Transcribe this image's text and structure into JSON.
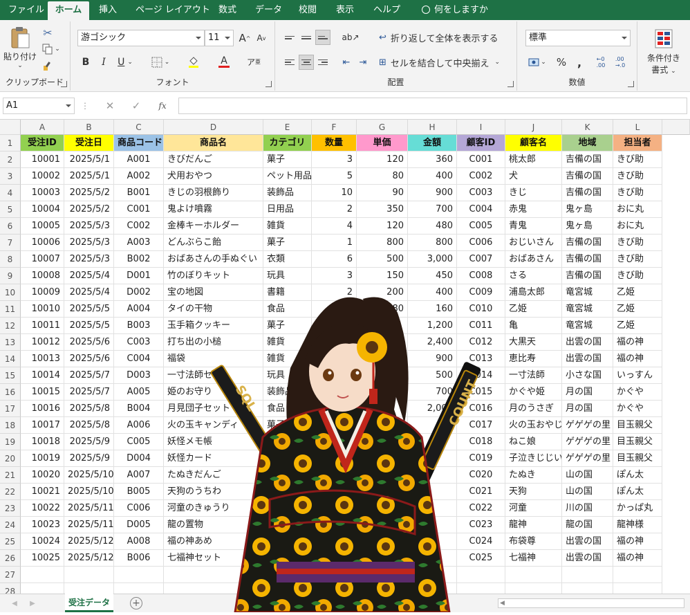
{
  "menu": {
    "tabs": [
      "ファイル",
      "ホーム",
      "挿入",
      "ページ レイアウト",
      "数式",
      "データ",
      "校閲",
      "表示",
      "ヘルプ"
    ],
    "active": "ホーム",
    "tell_me": "何をしますか"
  },
  "ribbon": {
    "clipboard": {
      "label": "クリップボード",
      "paste": "貼り付け"
    },
    "font": {
      "label": "フォント",
      "name": "游ゴシック",
      "size": "11",
      "grow": "A",
      "shrink": "A",
      "bold": "B",
      "italic": "I",
      "underline": "U"
    },
    "alignment": {
      "label": "配置",
      "wrap": "折り返して全体を表示する",
      "merge": "セルを結合して中央揃え"
    },
    "number": {
      "label": "数値",
      "format": "標準",
      "percent": "%",
      "comma": ","
    },
    "styles": {
      "conditional_line1": "条件付き",
      "conditional_line2": "書式"
    }
  },
  "formula_bar": {
    "name_box": "A1",
    "cancel": "✕",
    "enter": "✓",
    "fx": "fx",
    "content": ""
  },
  "sheet": {
    "columns": [
      "A",
      "B",
      "C",
      "D",
      "E",
      "F",
      "G",
      "H",
      "I",
      "J",
      "K",
      "L"
    ],
    "rows": [
      "1",
      "2",
      "3",
      "4",
      "5",
      "6",
      "7",
      "8",
      "9",
      "10",
      "11",
      "12",
      "13",
      "14",
      "15",
      "16",
      "17",
      "18",
      "19",
      "20",
      "21",
      "22",
      "23",
      "24",
      "25",
      "26",
      "27",
      "28"
    ],
    "header_colors": [
      "#92d050",
      "#ffff00",
      "#9bc2e6",
      "#ffe699",
      "#92d050",
      "#ffc000",
      "#ff99cc",
      "#66ddd6",
      "#b4a7d6",
      "#ffff00",
      "#a9d08e",
      "#f4b183"
    ],
    "headers": [
      "受注ID",
      "受注日",
      "商品コード",
      "商品名",
      "カテゴリ",
      "数量",
      "単価",
      "金額",
      "顧客ID",
      "顧客名",
      "地域",
      "担当者"
    ],
    "data": [
      [
        "10001",
        "2025/5/1",
        "A001",
        "きびだんご",
        "菓子",
        "3",
        "120",
        "360",
        "C001",
        "桃太郎",
        "吉備の国",
        "きび助"
      ],
      [
        "10002",
        "2025/5/1",
        "A002",
        "犬用おやつ",
        "ペット用品",
        "5",
        "80",
        "400",
        "C002",
        "犬",
        "吉備の国",
        "きび助"
      ],
      [
        "10003",
        "2025/5/2",
        "B001",
        "きじの羽根飾り",
        "装飾品",
        "10",
        "90",
        "900",
        "C003",
        "きじ",
        "吉備の国",
        "きび助"
      ],
      [
        "10004",
        "2025/5/2",
        "C001",
        "鬼よけ噴霧",
        "日用品",
        "2",
        "350",
        "700",
        "C004",
        "赤鬼",
        "鬼ヶ島",
        "おに丸"
      ],
      [
        "10005",
        "2025/5/3",
        "C002",
        "金棒キーホルダー",
        "雑貨",
        "4",
        "120",
        "480",
        "C005",
        "青鬼",
        "鬼ヶ島",
        "おに丸"
      ],
      [
        "10006",
        "2025/5/3",
        "A003",
        "どんぶらこ飴",
        "菓子",
        "1",
        "800",
        "800",
        "C006",
        "おじいさん",
        "吉備の国",
        "きび助"
      ],
      [
        "10007",
        "2025/5/3",
        "B002",
        "おばあさんの手ぬぐい",
        "衣類",
        "6",
        "500",
        "3,000",
        "C007",
        "おばあさん",
        "吉備の国",
        "きび助"
      ],
      [
        "10008",
        "2025/5/4",
        "D001",
        "竹のぼりキット",
        "玩具",
        "3",
        "150",
        "450",
        "C008",
        "さる",
        "吉備の国",
        "きび助"
      ],
      [
        "10009",
        "2025/5/4",
        "D002",
        "宝の地図",
        "書籍",
        "2",
        "200",
        "400",
        "C009",
        "浦島太郎",
        "竜宮城",
        "乙姫"
      ],
      [
        "10010",
        "2025/5/5",
        "A004",
        "タイの干物",
        "食品",
        "",
        "80",
        "160",
        "C010",
        "乙姫",
        "竜宮城",
        "乙姫"
      ],
      [
        "10011",
        "2025/5/5",
        "B003",
        "玉手箱クッキー",
        "菓子",
        "",
        "",
        "1,200",
        "C011",
        "亀",
        "竜宮城",
        "乙姫"
      ],
      [
        "10012",
        "2025/5/6",
        "C003",
        "打ち出の小槌",
        "雑貨",
        "",
        "",
        "2,400",
        "C012",
        "大黒天",
        "出雲の国",
        "福の神"
      ],
      [
        "10013",
        "2025/5/6",
        "C004",
        "福袋",
        "雑貨",
        "",
        "",
        "900",
        "C013",
        "恵比寿",
        "出雲の国",
        "福の神"
      ],
      [
        "10014",
        "2025/5/7",
        "D003",
        "一寸法師セット",
        "玩具",
        "",
        "",
        "500",
        "C014",
        "一寸法師",
        "小さな国",
        "いっすん"
      ],
      [
        "10015",
        "2025/5/7",
        "A005",
        "姫のお守り",
        "装飾品",
        "",
        "",
        "700",
        "C015",
        "かぐや姫",
        "月の国",
        "かぐや"
      ],
      [
        "10016",
        "2025/5/8",
        "B004",
        "月見団子セット",
        "食品",
        "",
        "",
        "2,000",
        "C016",
        "月のうさぎ",
        "月の国",
        "かぐや"
      ],
      [
        "10017",
        "2025/5/8",
        "A006",
        "火の玉キャンディ",
        "菓子",
        "",
        "",
        "",
        "C017",
        "火の玉おやじ",
        "ゲゲゲの里",
        "目玉親父"
      ],
      [
        "10018",
        "2025/5/9",
        "C005",
        "妖怪メモ帳",
        "",
        "",
        "",
        "",
        "C018",
        "ねこ娘",
        "ゲゲゲの里",
        "目玉親父"
      ],
      [
        "10019",
        "2025/5/9",
        "D004",
        "妖怪カード",
        "",
        "",
        "",
        "",
        "C019",
        "子泣きじじい",
        "ゲゲゲの里",
        "目玉親父"
      ],
      [
        "10020",
        "2025/5/10",
        "A007",
        "たぬきだんご",
        "",
        "",
        "",
        "",
        "C020",
        "たぬき",
        "山の国",
        "ぽん太"
      ],
      [
        "10021",
        "2025/5/10",
        "B005",
        "天狗のうちわ",
        "",
        "",
        "",
        "",
        "C021",
        "天狗",
        "山の国",
        "ぽん太"
      ],
      [
        "10022",
        "2025/5/11",
        "C006",
        "河童のきゅうり",
        "",
        "",
        "",
        "",
        "C022",
        "河童",
        "川の国",
        "かっぱ丸"
      ],
      [
        "10023",
        "2025/5/11",
        "D005",
        "龍の置物",
        "",
        "",
        "",
        "",
        "C023",
        "龍神",
        "龍の国",
        "龍神様"
      ],
      [
        "10024",
        "2025/5/12",
        "A008",
        "福の神あめ",
        "",
        "",
        "",
        "",
        "C024",
        "布袋尊",
        "出雲の国",
        "福の神"
      ],
      [
        "10025",
        "2025/5/12",
        "B006",
        "七福神セット",
        "",
        "",
        "",
        "",
        "C025",
        "七福神",
        "出雲の国",
        "福の神"
      ]
    ]
  },
  "sheet_tabs": {
    "active": "受注データ",
    "add": "+"
  },
  "character": {
    "sword_left": "SQL",
    "sword_right": "COUNT"
  }
}
